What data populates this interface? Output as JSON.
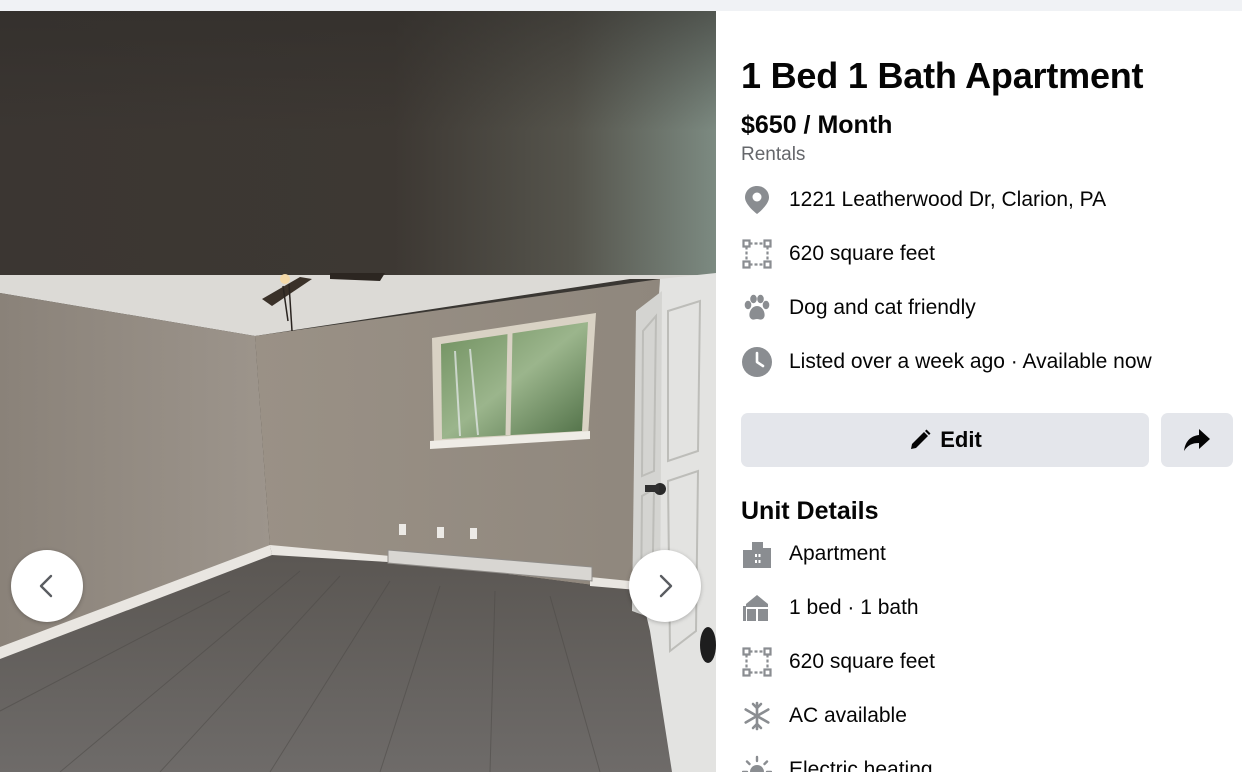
{
  "listing": {
    "title": "1 Bed 1 Bath Apartment",
    "price": "$650 / Month",
    "category": "Rentals",
    "info_rows": [
      {
        "icon": "location-pin-icon",
        "text": "1221 Leatherwood Dr, Clarion, PA"
      },
      {
        "icon": "square-footage-icon",
        "text": "620 square feet"
      },
      {
        "icon": "paw-icon",
        "text": "Dog and cat friendly"
      },
      {
        "icon": "clock-icon",
        "text": "Listed over a week ago · Available now"
      }
    ]
  },
  "actions": {
    "edit_label": "Edit",
    "edit_icon": "pencil-icon",
    "share_icon": "share-arrow-icon"
  },
  "unit_details": {
    "heading": "Unit Details",
    "items": [
      {
        "icon": "building-icon",
        "text": "Apartment"
      },
      {
        "icon": "house-icon",
        "text": "1 bed · 1 bath"
      },
      {
        "icon": "square-footage-icon",
        "text": "620 square feet"
      },
      {
        "icon": "snowflake-icon",
        "text": "AC available"
      },
      {
        "icon": "sun-heat-icon",
        "text": "Electric heating"
      }
    ]
  },
  "gallery": {
    "prev_icon": "chevron-left-icon",
    "next_icon": "chevron-right-icon"
  },
  "colors": {
    "button_bg": "#e4e6eb",
    "icon_gray": "#8a8d91",
    "secondary_text": "#65676b"
  }
}
